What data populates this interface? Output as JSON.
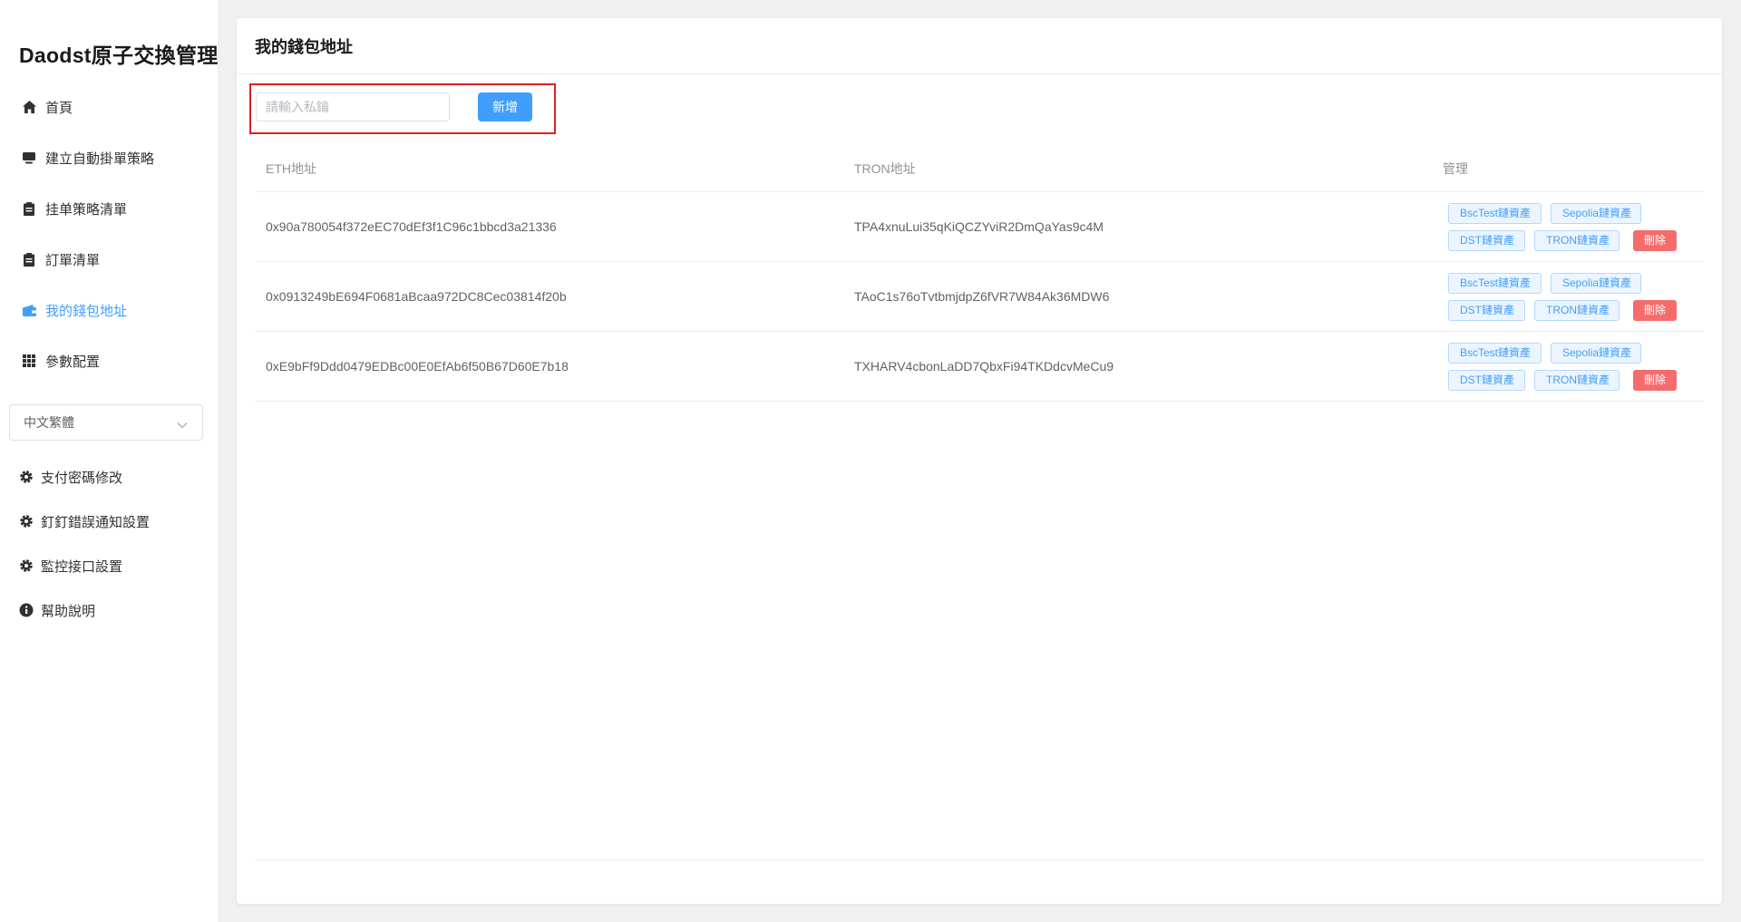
{
  "sidebar": {
    "brand": "Daodst原子交換管理",
    "nav": [
      {
        "label": "首頁",
        "icon": "home-icon"
      },
      {
        "label": "建立自動掛單策略",
        "icon": "monitor-icon"
      },
      {
        "label": "挂单策略清單",
        "icon": "clipboard-icon"
      },
      {
        "label": "訂單清單",
        "icon": "clipboard-icon"
      },
      {
        "label": "我的錢包地址",
        "icon": "wallet-icon",
        "active": true
      },
      {
        "label": "參數配置",
        "icon": "grid-icon"
      }
    ],
    "language": "中文繁體",
    "settings": [
      {
        "label": "支付密碼修改",
        "icon": "gear-icon"
      },
      {
        "label": "釘釘錯誤通知設置",
        "icon": "gear-icon"
      },
      {
        "label": "監控接口設置",
        "icon": "gear-icon"
      },
      {
        "label": "幫助說明",
        "icon": "info-icon"
      }
    ]
  },
  "main": {
    "title": "我的錢包地址",
    "key_placeholder": "請輸入私鑰",
    "add_label": "新增",
    "columns": {
      "eth": "ETH地址",
      "tron": "TRON地址",
      "manage": "管理"
    },
    "rows": [
      {
        "eth": "0x90a780054f372eEC70dEf3f1C96c1bbcd3a21336",
        "tron": "TPA4xnuLui35qKiQCZYviR2DmQaYas9c4M"
      },
      {
        "eth": "0x0913249bE694F0681aBcaa972DC8Cec03814f20b",
        "tron": "TAoC1s76oTvtbmjdpZ6fVR7W84Ak36MDW6"
      },
      {
        "eth": "0xE9bFf9Ddd0479EDBc00E0EfAb6f50B67D60E7b18",
        "tron": "TXHARV4cbonLaDD7QbxFi94TKDdcvMeCu9"
      }
    ],
    "actions": {
      "bsc": "BscTest鏈資產",
      "sepolia": "Sepolia鏈資產",
      "dst": "DST鏈資產",
      "tron": "TRON鏈資產",
      "delete": "刪除"
    },
    "colors": {
      "primary": "#409eff",
      "danger": "#f56c6c",
      "highlight_box": "#e0201f"
    }
  }
}
